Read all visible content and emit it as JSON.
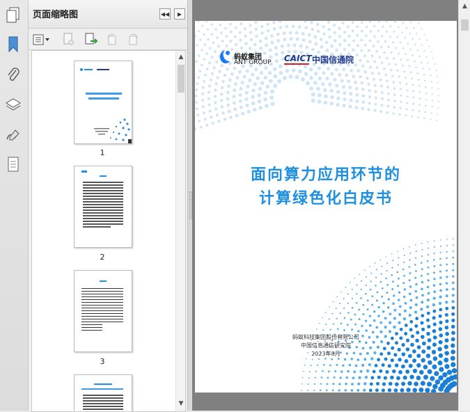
{
  "panel": {
    "title": "页面缩略图",
    "thumbnails": [
      {
        "page_label": "1"
      },
      {
        "page_label": "2"
      },
      {
        "page_label": "3"
      }
    ]
  },
  "document": {
    "logo_ant_cn": "蚂蚁集团",
    "logo_ant_en": "ANT GROUP",
    "logo_caict_en": "CAICT",
    "logo_caict_cn": "中国信通院",
    "title_line1": "面向算力应用环节的",
    "title_line2": "计算绿色化白皮书",
    "publisher1": "蚂蚁科技集团股份有限公司",
    "publisher2": "中国信息通信研究院",
    "date": "2023年8月"
  },
  "colors": {
    "accent_blue": "#1f8fe0",
    "dot_light": "#cfe4f7",
    "dot_dark": "#1a7fd6",
    "caict_navy": "#1e3a8a",
    "caict_red": "#d62020"
  }
}
